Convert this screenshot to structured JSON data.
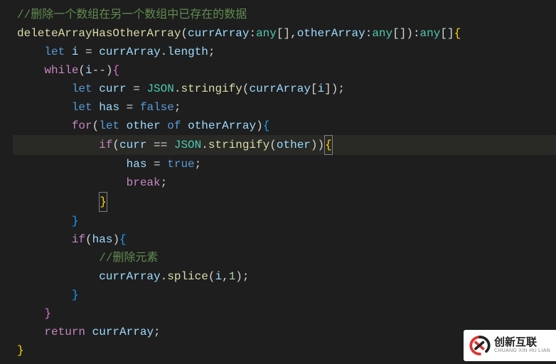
{
  "code": {
    "l1_comment": "//删除一个数组在另一个数组中已存在的数据",
    "l2_func": "deleteArrayHasOtherArray",
    "l2_p1": "currArray",
    "l2_p2": "otherArray",
    "l2_type_any": "any",
    "l3_let": "let",
    "l3_i": "i",
    "l3_currArray": "currArray",
    "l3_length": "length",
    "l4_while": "while",
    "l5_let": "let",
    "l5_curr": "curr",
    "l5_JSON": "JSON",
    "l5_stringify": "stringify",
    "l5_currArray": "currArray",
    "l5_i": "i",
    "l6_let": "let",
    "l6_has": "has",
    "l6_false": "false",
    "l7_for": "for",
    "l7_let": "let",
    "l7_other": "other",
    "l7_of": "of",
    "l7_otherArray": "otherArray",
    "l8_if": "if",
    "l8_curr": "curr",
    "l8_JSON": "JSON",
    "l8_stringify": "stringify",
    "l8_other": "other",
    "l9_has": "has",
    "l9_true": "true",
    "l10_break": "break",
    "l13_if": "if",
    "l13_has": "has",
    "l14_comment": "//删除元素",
    "l15_currArray": "currArray",
    "l15_splice": "splice",
    "l15_i": "i",
    "l15_1": "1",
    "l18_return": "return",
    "l18_currArray": "currArray"
  },
  "watermark": {
    "cn": "创新互联",
    "en": "CHUANG XIN HU LIAN"
  }
}
